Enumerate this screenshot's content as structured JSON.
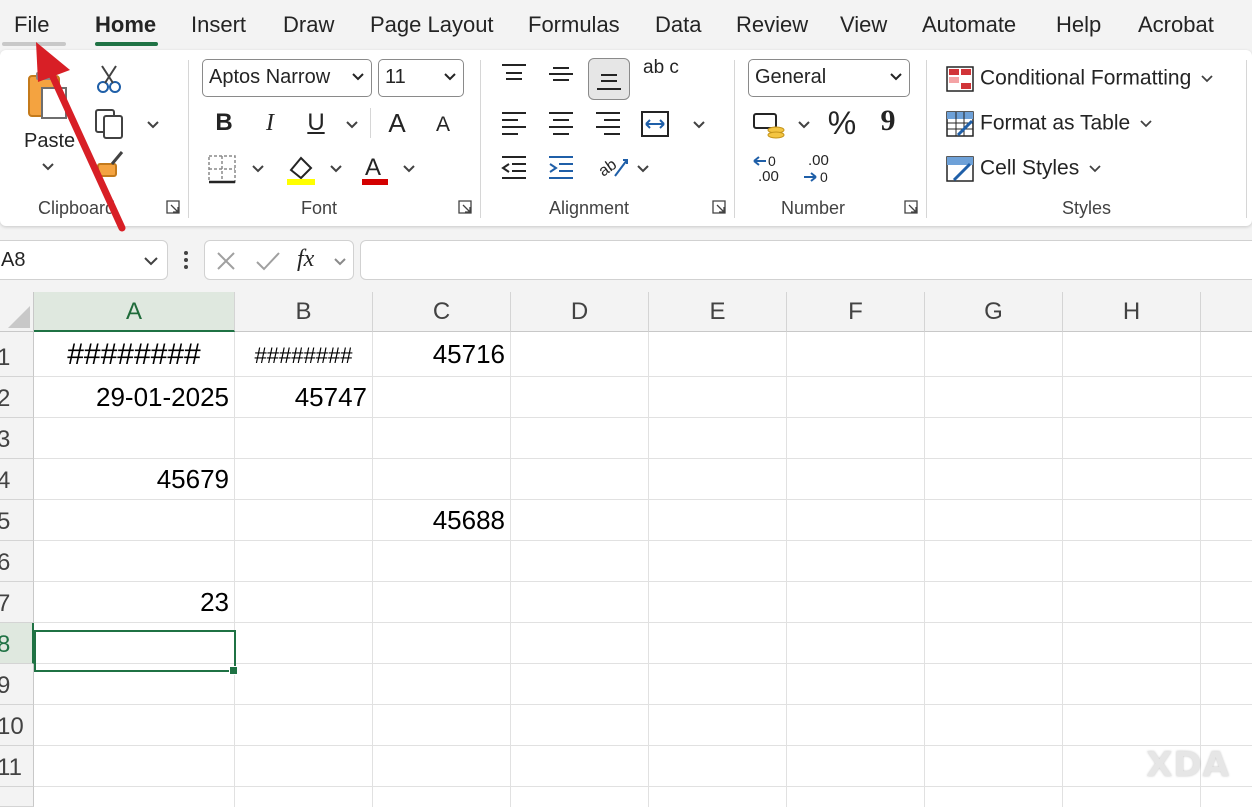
{
  "tabs": [
    "File",
    "Home",
    "Insert",
    "Draw",
    "Page Layout",
    "Formulas",
    "Data",
    "Review",
    "View",
    "Automate",
    "Help",
    "Acrobat"
  ],
  "active_tab": "Home",
  "colors": {
    "accent_green": "#1f7244",
    "annotation_arrow": "#d81f26",
    "highlight_yellow": "#ffff00",
    "font_red": "#d40000"
  },
  "ribbon": {
    "clipboard": {
      "label": "Clipboard",
      "paste_label": "Paste"
    },
    "font": {
      "label": "Font",
      "font_name": "Aptos Narrow",
      "font_size": "11",
      "buttons": [
        "B",
        "I",
        "U",
        "A",
        "A"
      ]
    },
    "alignment": {
      "label": "Alignment",
      "wrap_glyph": "ab c"
    },
    "number": {
      "label": "Number",
      "format": "General",
      "percent": "%",
      "comma": "9",
      "increase_decimal": ".00",
      "decrease_decimal": ".00"
    },
    "styles": {
      "label": "Styles",
      "items": [
        "Conditional Formatting",
        "Format as Table",
        "Cell Styles"
      ]
    }
  },
  "formula_bar": {
    "name_box": "A8",
    "fx": "fx",
    "formula": ""
  },
  "columns": [
    "A",
    "B",
    "C",
    "D",
    "E",
    "F",
    "G",
    "H"
  ],
  "rows": [
    "1",
    "2",
    "3",
    "4",
    "5",
    "6",
    "7",
    "8",
    "9",
    "10",
    "11"
  ],
  "cells": {
    "A1": "########",
    "B1": "########",
    "C1": "45716",
    "A2": "29-01-2025",
    "B2": "45747",
    "A4": "45679",
    "C5": "45688",
    "A7": "23"
  },
  "selected_cell": "A8",
  "watermark": "XDA"
}
